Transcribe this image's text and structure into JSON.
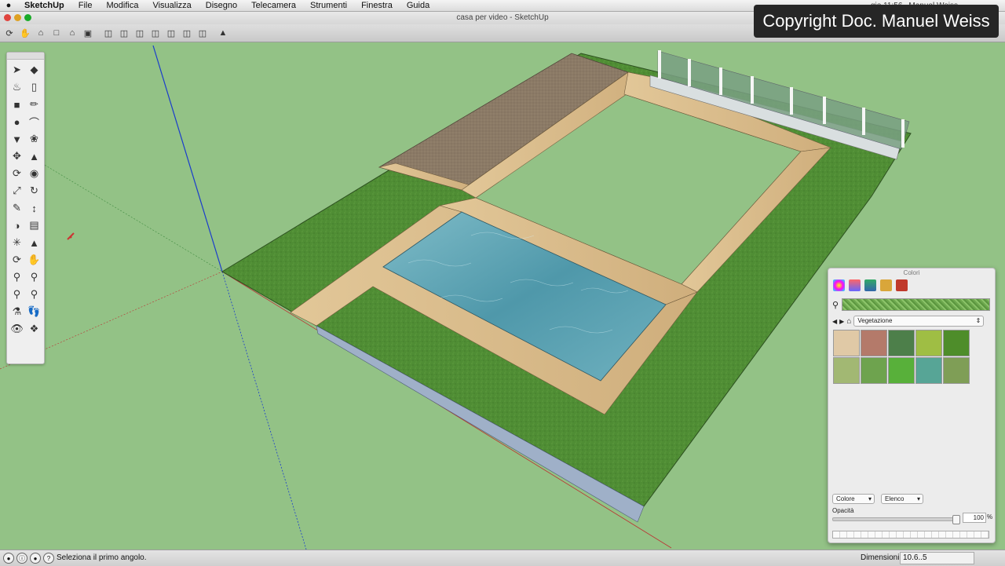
{
  "menubar": {
    "apple_icon": "apple-icon",
    "app_name": "SketchUp",
    "items": [
      "File",
      "Modifica",
      "Visualizza",
      "Disegno",
      "Telecamera",
      "Strumenti",
      "Finestra",
      "Guida"
    ],
    "user": "Manuel Weiss",
    "clock": "gio 11:56"
  },
  "window": {
    "title": "casa per video - SketchUp"
  },
  "overlay": {
    "copyright": "Copyright Doc. Manuel Weiss"
  },
  "status": {
    "message": "Seleziona il primo angolo.",
    "dimension_label": "Dimensioni",
    "dimension_value": "10.6..5"
  },
  "colors_panel": {
    "title": "Colori",
    "library": "Vegetazione",
    "color_select": "Colore",
    "list_select": "Elenco",
    "opacity_label": "Opacità",
    "opacity_value": "100",
    "opacity_unit": "%",
    "opacity_fraction": 1.0
  },
  "colors": {
    "grass": "#4f8d34",
    "wood": "#d9bc8c",
    "water": "#5fa6b5",
    "gravel": "#8b7a66",
    "background": "#93c286"
  }
}
